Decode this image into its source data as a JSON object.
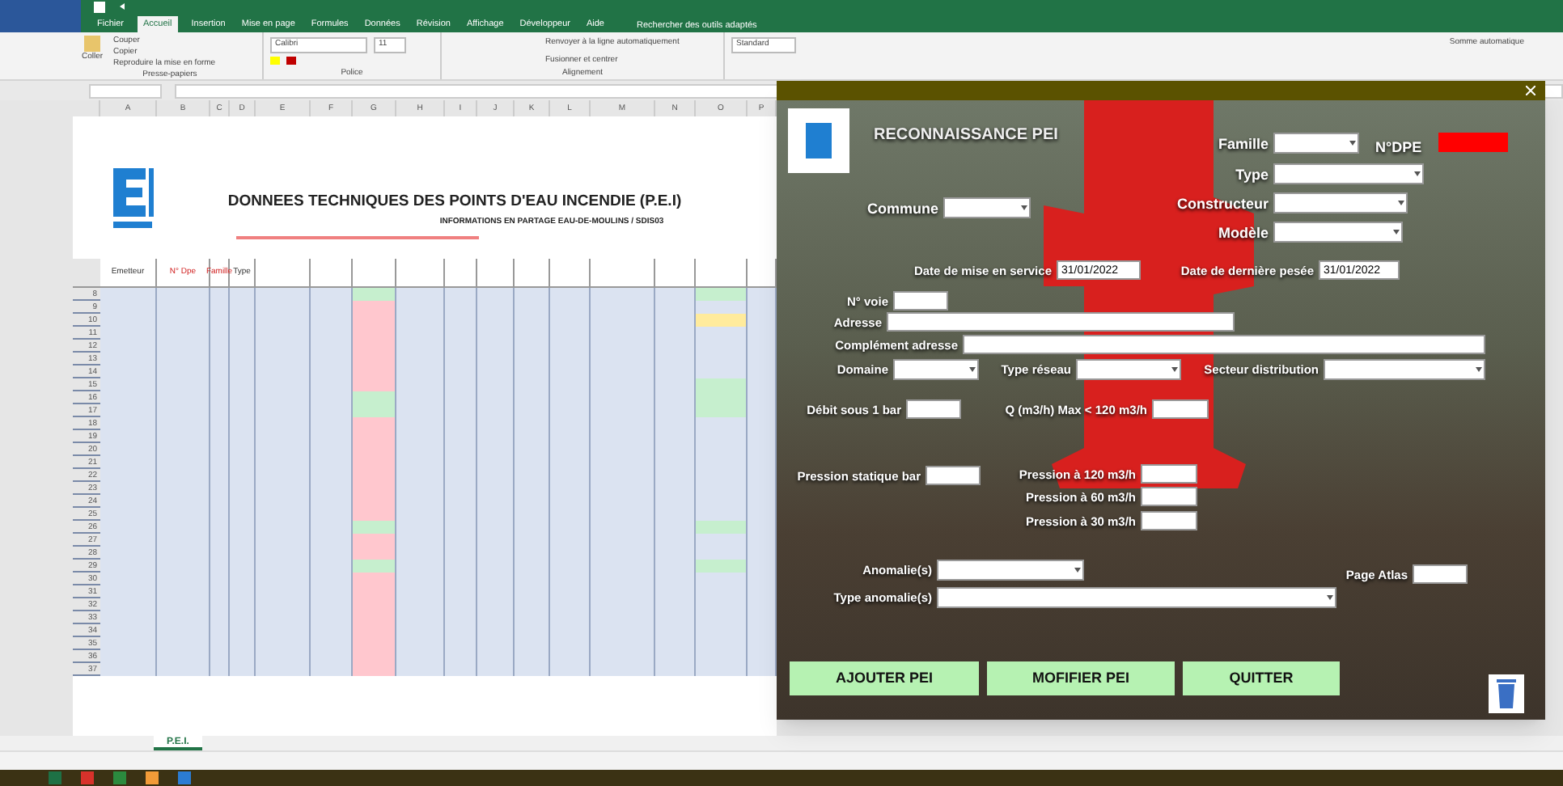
{
  "excel": {
    "ribbon_tabs": [
      {
        "label": "Fichier",
        "selected": false
      },
      {
        "label": "Accueil",
        "selected": true
      },
      {
        "label": "Insertion",
        "selected": false
      },
      {
        "label": "Mise en page",
        "selected": false
      },
      {
        "label": "Formules",
        "selected": false
      },
      {
        "label": "Données",
        "selected": false
      },
      {
        "label": "Révision",
        "selected": false
      },
      {
        "label": "Affichage",
        "selected": false
      },
      {
        "label": "Développeur",
        "selected": false
      },
      {
        "label": "Aide",
        "selected": false
      }
    ],
    "tell_me": "Rechercher des outils adaptés",
    "clipboard": {
      "paste": "Coller",
      "cut": "Couper",
      "copy": "Copier",
      "format_painter": "Reproduire la mise en forme",
      "group": "Presse-papiers"
    },
    "font": {
      "name": "Calibri",
      "size": "11",
      "group": "Police"
    },
    "alignment": {
      "wrap": "Renvoyer à la ligne automatiquement",
      "merge": "Fusionner et centrer",
      "group": "Alignement"
    },
    "number_format": "Standard",
    "autosum": "Somme automatique"
  },
  "sheet": {
    "column_letters": [
      "A",
      "B",
      "C",
      "D",
      "E",
      "F",
      "G",
      "H",
      "I",
      "J",
      "K",
      "L",
      "M",
      "N",
      "O",
      "P"
    ],
    "title": "DONNEES TECHNIQUES DES POINTS D'EAU INCENDIE (P.E.I)",
    "subtitle": "INFORMATIONS EN PARTAGE EAU-DE-MOULINS / SDIS03",
    "headers": [
      "Emetteur",
      "N° Dpe",
      "Famille",
      "Type"
    ],
    "rows": [
      {
        "row_number": "8",
        "flow_cell": {
          "color": "#c6efce"
        },
        "state_cell": {
          "color": "#c6efce"
        }
      },
      {
        "row_number": "9",
        "flow_cell": {
          "color": "#ffc7ce"
        }
      },
      {
        "row_number": "10",
        "flow_cell": {
          "color": "#ffc7ce"
        },
        "state_cell": {
          "color": "#ffeb9c"
        }
      },
      {
        "row_number": "11",
        "flow_cell": {
          "color": "#ffc7ce"
        }
      },
      {
        "row_number": "12",
        "flow_cell": {
          "color": "#ffc7ce"
        }
      },
      {
        "row_number": "13",
        "flow_cell": {
          "color": "#ffc7ce"
        }
      },
      {
        "row_number": "14",
        "flow_cell": {
          "color": "#ffc7ce"
        }
      },
      {
        "row_number": "15",
        "flow_cell": {
          "color": "#ffc7ce"
        },
        "state_cell": {
          "color": "#c6efce"
        }
      },
      {
        "row_number": "16",
        "flow_cell": {
          "color": "#c6efce"
        },
        "state_cell": {
          "color": "#c6efce"
        }
      },
      {
        "row_number": "17",
        "flow_cell": {
          "color": "#c6efce"
        },
        "state_cell": {
          "color": "#c6efce"
        }
      },
      {
        "row_number": "18",
        "flow_cell": {
          "color": "#ffc7ce"
        }
      },
      {
        "row_number": "19",
        "flow_cell": {
          "color": "#ffc7ce"
        }
      },
      {
        "row_number": "20",
        "flow_cell": {
          "color": "#ffc7ce"
        }
      },
      {
        "row_number": "21",
        "flow_cell": {
          "color": "#ffc7ce"
        }
      },
      {
        "row_number": "22",
        "flow_cell": {
          "color": "#ffc7ce"
        }
      },
      {
        "row_number": "23",
        "flow_cell": {
          "color": "#ffc7ce"
        }
      },
      {
        "row_number": "24",
        "flow_cell": {
          "color": "#ffc7ce"
        }
      },
      {
        "row_number": "25",
        "flow_cell": {
          "color": "#ffc7ce"
        }
      },
      {
        "row_number": "26",
        "flow_cell": {
          "color": "#c6efce"
        },
        "state_cell": {
          "color": "#c6efce"
        }
      },
      {
        "row_number": "27",
        "flow_cell": {
          "color": "#ffc7ce"
        }
      },
      {
        "row_number": "28",
        "flow_cell": {
          "color": "#ffc7ce"
        }
      },
      {
        "row_number": "29",
        "flow_cell": {
          "color": "#c6efce"
        },
        "state_cell": {
          "color": "#c6efce"
        }
      },
      {
        "row_number": "30",
        "flow_cell": {
          "color": "#ffc7ce"
        }
      },
      {
        "row_number": "31",
        "flow_cell": {
          "color": "#ffc7ce"
        }
      },
      {
        "row_number": "32",
        "flow_cell": {
          "color": "#ffc7ce"
        }
      },
      {
        "row_number": "33",
        "flow_cell": {
          "color": "#ffc7ce"
        }
      },
      {
        "row_number": "34",
        "flow_cell": {
          "color": "#ffc7ce"
        }
      },
      {
        "row_number": "35",
        "flow_cell": {
          "color": "#ffc7ce"
        }
      },
      {
        "row_number": "36",
        "flow_cell": {
          "color": "#ffc7ce"
        }
      },
      {
        "row_number": "37",
        "flow_cell": {
          "color": "#ffc7ce"
        }
      }
    ],
    "sheet_tabs": [
      {
        "label": "P.E.I.",
        "selected": true
      }
    ]
  },
  "form": {
    "heading": "RECONNAISSANCE PEI",
    "dpe": {
      "label": "N°DPE",
      "color": "#ff0000"
    },
    "fields": [
      {
        "label": "Famille",
        "kind": "dropdown"
      },
      {
        "label": "Type",
        "kind": "dropdown"
      },
      {
        "label": "Commune",
        "kind": "dropdown"
      },
      {
        "label": "Constructeur",
        "kind": "dropdown"
      },
      {
        "label": "Modèle",
        "kind": "dropdown"
      },
      {
        "label": "Date de mise en service",
        "kind": "text",
        "value": "31/01/2022"
      },
      {
        "label": "Date de dernière pesée",
        "kind": "text",
        "value": "31/01/2022"
      },
      {
        "label": "N° voie",
        "kind": "text"
      },
      {
        "label": "Adresse",
        "kind": "text"
      },
      {
        "label": "Complément adresse",
        "kind": "text"
      },
      {
        "label": "Domaine",
        "kind": "dropdown"
      },
      {
        "label": "Type réseau",
        "kind": "dropdown"
      },
      {
        "label": "Secteur distribution",
        "kind": "dropdown"
      },
      {
        "label": "Débit sous 1 bar",
        "kind": "text"
      },
      {
        "label": "Q (m3/h) Max < 120 m3/h",
        "kind": "text"
      },
      {
        "label": "Pression statique bar",
        "kind": "text"
      },
      {
        "label": "Pression à 120 m3/h",
        "kind": "text"
      },
      {
        "label": "Pression à 60 m3/h",
        "kind": "text"
      },
      {
        "label": "Pression à 30 m3/h",
        "kind": "text"
      },
      {
        "label": "Anomalie(s)",
        "kind": "dropdown"
      },
      {
        "label": "Page Atlas",
        "kind": "text"
      },
      {
        "label": "Type anomalie(s)",
        "kind": "dropdown"
      }
    ],
    "buttons": [
      "AJOUTER PEI",
      "MOFIFIER PEI",
      "QUITTER"
    ]
  }
}
